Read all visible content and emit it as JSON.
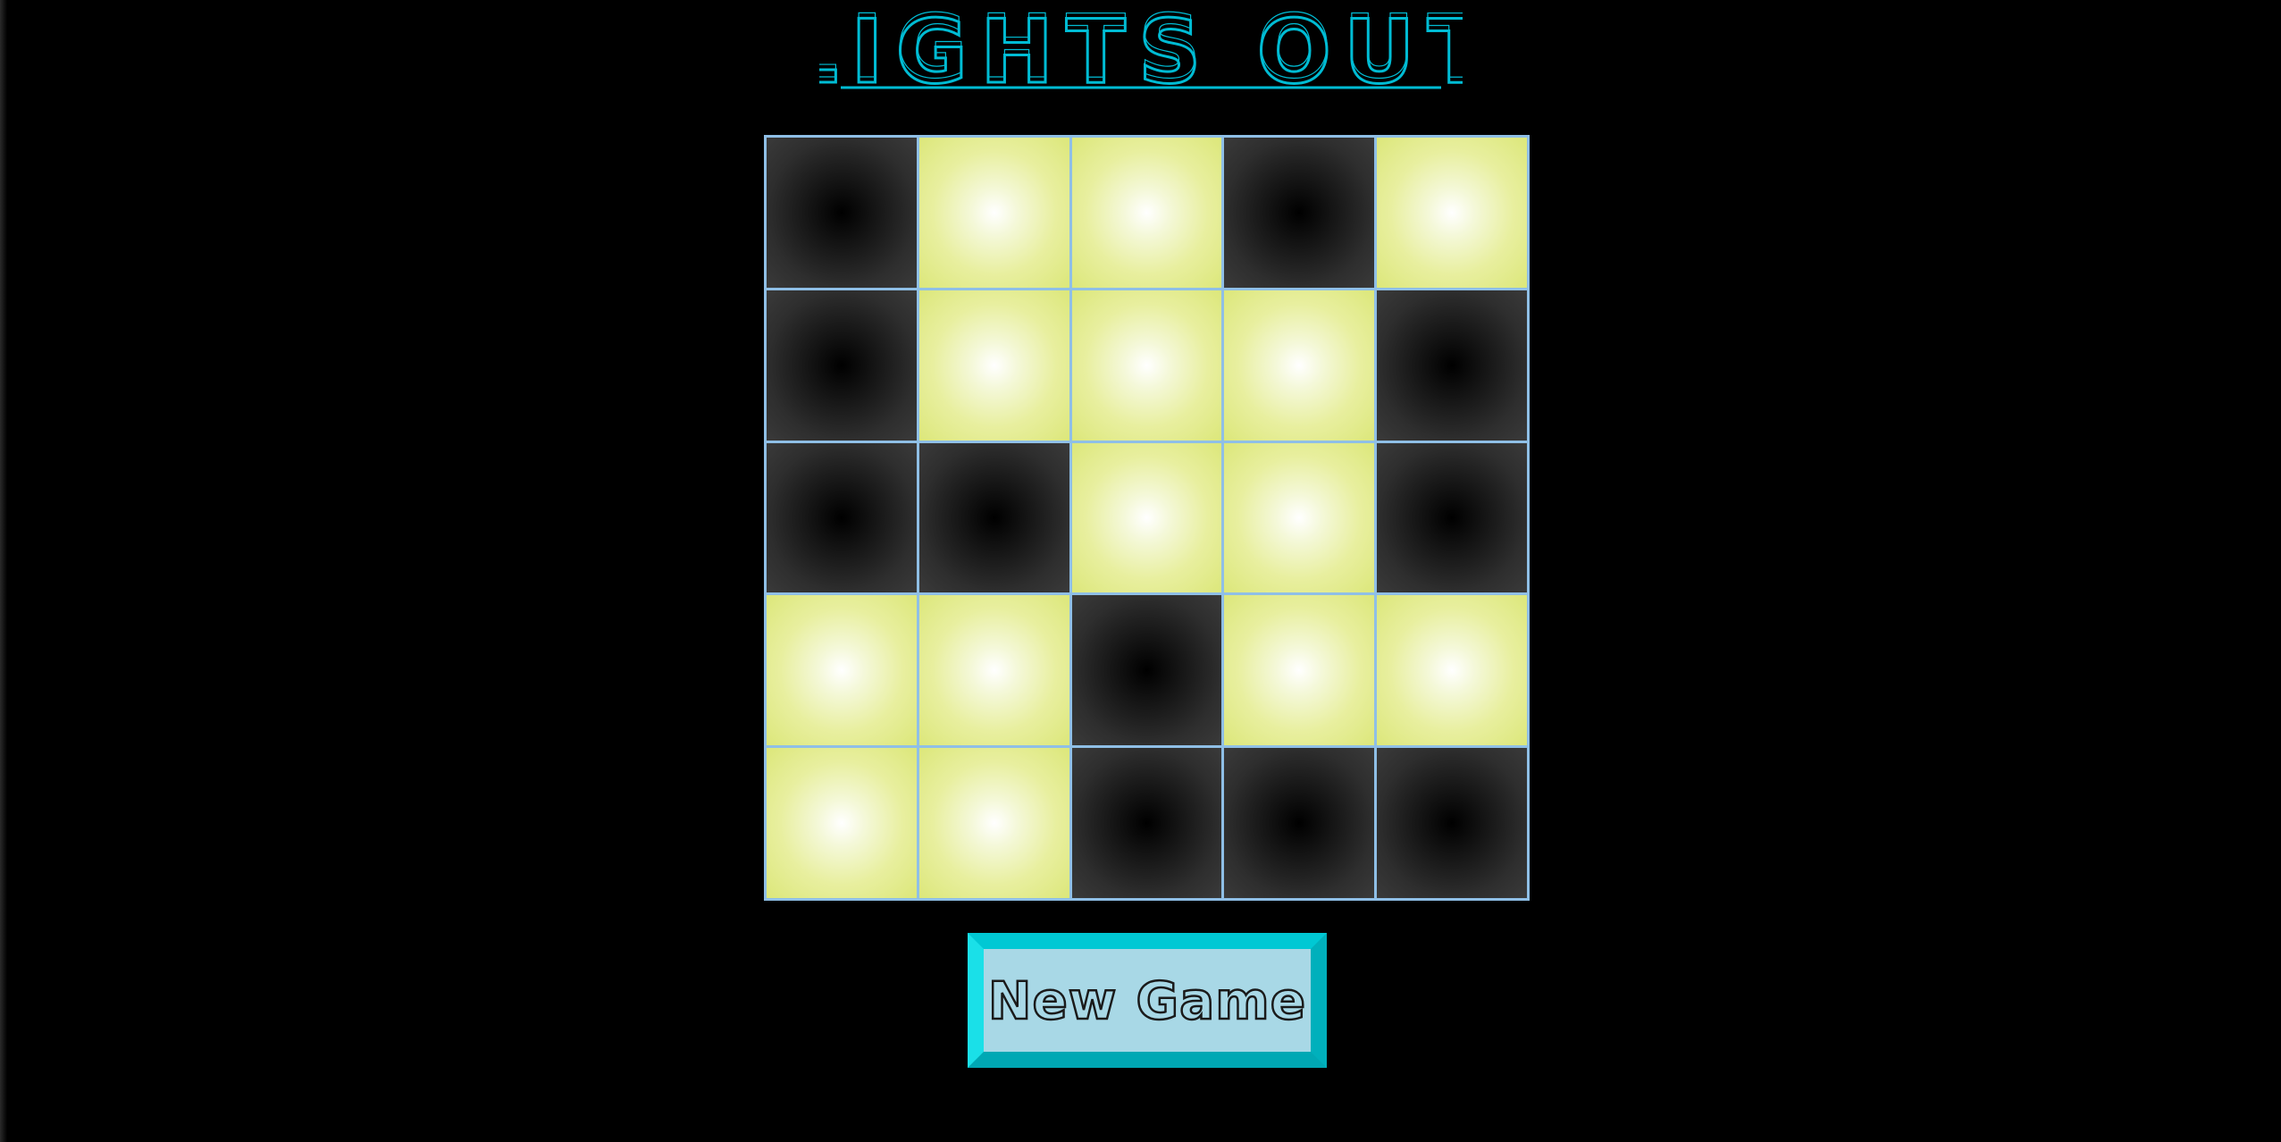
{
  "title": "LIGHTS OUT",
  "colors": {
    "background": "#000000",
    "title": "#00bcd4",
    "grid_lines": "#8fbfe6",
    "light_on": "#e8ef9f",
    "light_off": "#000000",
    "button_face": "#a8d8e6",
    "button_bevel": "#00c8d4"
  },
  "board": {
    "rows": 5,
    "cols": 5,
    "cells": [
      [
        0,
        1,
        1,
        0,
        1
      ],
      [
        0,
        1,
        1,
        1,
        0
      ],
      [
        0,
        0,
        1,
        1,
        0
      ],
      [
        1,
        1,
        0,
        1,
        1
      ],
      [
        1,
        1,
        0,
        0,
        0
      ]
    ]
  },
  "button": {
    "label": "New Game"
  }
}
